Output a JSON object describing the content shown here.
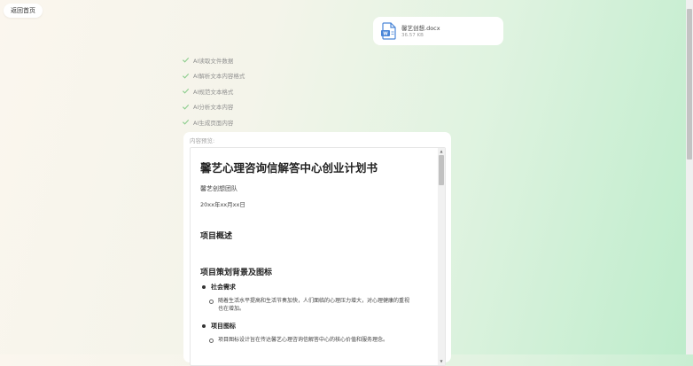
{
  "back_button": {
    "label": "返回首页"
  },
  "file": {
    "name": "馨艺创想.docx",
    "size": "36.57 KB",
    "icon": "word-document-icon"
  },
  "steps": [
    {
      "label": "AI读取文件数据",
      "icon": "check-icon"
    },
    {
      "label": "AI解析文本内容格式",
      "icon": "check-icon"
    },
    {
      "label": "AI规范文本格式",
      "icon": "check-icon"
    },
    {
      "label": "AI分析文本内容",
      "icon": "check-icon"
    },
    {
      "label": "AI生成页面内容",
      "icon": "check-icon"
    }
  ],
  "preview": {
    "label": "内容预览:",
    "doc": {
      "title": "馨艺心理咨询信解答中心创业计划书",
      "team": "馨艺创想团队",
      "date": "20xx年xx月xx日",
      "section1": "项目概述",
      "section2": "项目策划背景及图标",
      "bullet1": "社会需求",
      "bullet1_text": "随着生活水平提高和生活节奏加快，人们面临的心理压力增大，对心理健康的重视也在增加。",
      "bullet2": "项目图标",
      "bullet2_text": "项目图标设计旨在传达馨艺心理咨询信解答中心的核心价值和服务理念。"
    }
  },
  "colors": {
    "check": "#8fce8f",
    "accent": "#5b8ed6"
  }
}
